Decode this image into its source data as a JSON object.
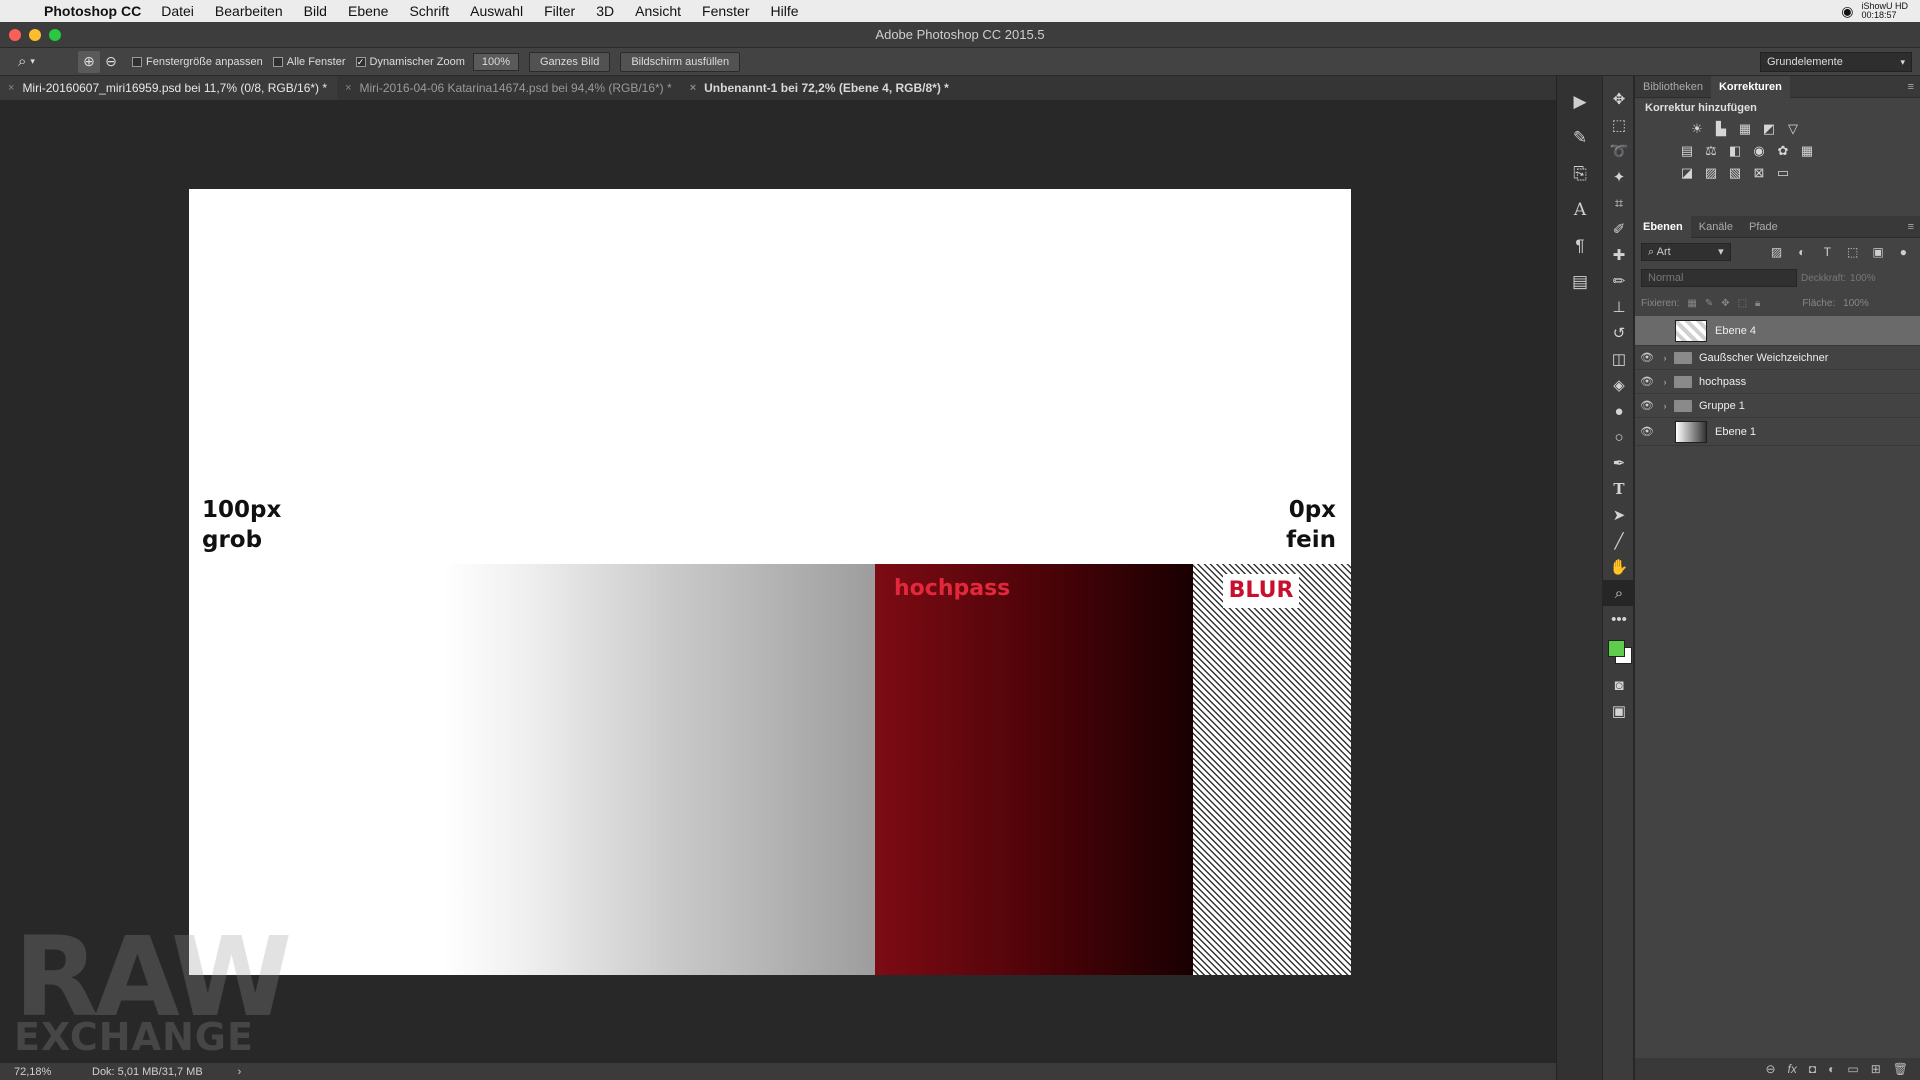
{
  "menubar": {
    "app": "Photoshop CC",
    "items": [
      "Datei",
      "Bearbeiten",
      "Bild",
      "Ebene",
      "Schrift",
      "Auswahl",
      "Filter",
      "3D",
      "Ansicht",
      "Fenster",
      "Hilfe"
    ],
    "user_line1": "iShowU HD",
    "user_line2": "00:18:57"
  },
  "window": {
    "title": "Adobe Photoshop CC 2015.5"
  },
  "options": {
    "fit_window_label": "Fenstergröße anpassen",
    "all_windows_label": "Alle Fenster",
    "dynamic_zoom_label": "Dynamischer Zoom",
    "dynamic_zoom_checked": "✓",
    "zoom_value": "100%",
    "fit_screen_button": "Ganzes Bild",
    "fill_screen_button": "Bildschirm ausfüllen",
    "workspace": "Grundelemente"
  },
  "tabs": [
    {
      "label": "Miri-20160607_miri16959.psd bei 11,7% (0/8, RGB/16*) *"
    },
    {
      "label": "Miri-2016-04-06 Katarina14674.psd bei 94,4% (RGB/16*) *"
    },
    {
      "label": "Unbenannt-1 bei 72,2% (Ebene 4, RGB/8*) *"
    }
  ],
  "canvas": {
    "left_line1": "100px",
    "left_line2": "grob",
    "right_line1": "0px",
    "right_line2": "fein",
    "red_label": "hochpass",
    "hatch_label": "BLUR"
  },
  "watermark": {
    "line1": "RAW",
    "line2": "EXCHANGE"
  },
  "status": {
    "zoom": "72,18%",
    "doc": "Dok: 5,01 MB/31,7 MB"
  },
  "panels": {
    "top_tabs": [
      "Bibliotheken",
      "Korrekturen"
    ],
    "korrektur_label": "Korrektur hinzufügen",
    "layer_tabs": [
      "Ebenen",
      "Kanäle",
      "Pfade"
    ],
    "filter_kind": "Art",
    "blend_mode": "Normal",
    "opacity_label": "Deckkraft:",
    "opacity_value": "100%",
    "lock_label": "Fixieren:",
    "fill_label": "Fläche:",
    "fill_value": "100%"
  },
  "layers": [
    {
      "name": "Ebene 4"
    },
    {
      "name": "Gaußscher Weichzeichner"
    },
    {
      "name": "hochpass"
    },
    {
      "name": "Gruppe 1"
    },
    {
      "name": "Ebene 1"
    }
  ],
  "colors": {
    "foreground": "#5fcd4c",
    "background": "#ffffff",
    "hochpass_text": "#e4283b",
    "blur_text": "#c8102e"
  }
}
